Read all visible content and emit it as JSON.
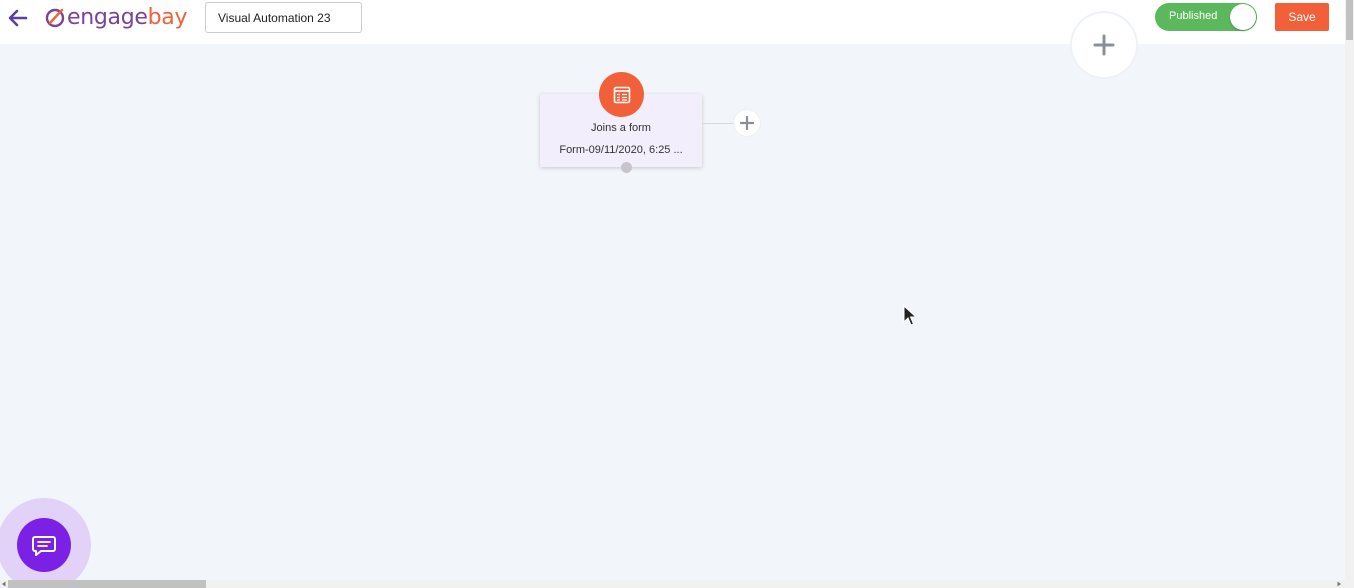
{
  "header": {
    "logo_engage": "engage",
    "logo_bay": "bay",
    "workflow_name": "Visual Automation 23",
    "publish_toggle_label": "Published",
    "publish_toggle_on": true,
    "save_label": "Save"
  },
  "canvas": {
    "trigger_node": {
      "title": "Joins a form",
      "subtitle": "Form-09/11/2020, 6:25 ..."
    }
  },
  "colors": {
    "brand_purple": "#7b4397",
    "brand_orange": "#f2603a",
    "toggle_green": "#5cb85c",
    "chat_purple": "#7b21e6",
    "canvas_bg": "#f2f5f9"
  },
  "icons": {
    "back": "arrow-left-icon",
    "add": "plus-icon",
    "trigger": "form-icon",
    "chat": "chat-bubble-icon"
  }
}
